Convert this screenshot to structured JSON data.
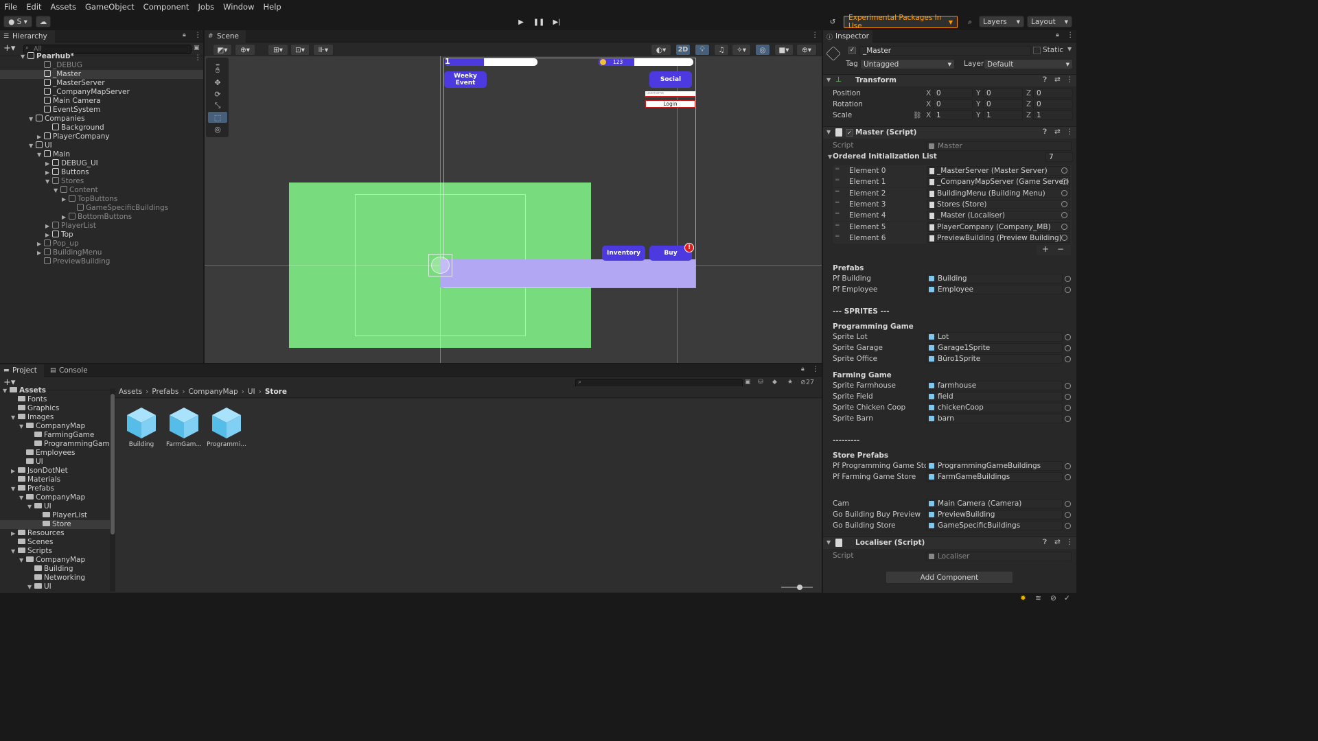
{
  "menu": [
    "File",
    "Edit",
    "Assets",
    "GameObject",
    "Component",
    "Jobs",
    "Window",
    "Help"
  ],
  "toolbar": {
    "account": "S",
    "experimental": "Experimental Packages In Use",
    "layers": "Layers",
    "layout": "Layout"
  },
  "hierarchy": {
    "tab": "Hierarchy",
    "search_placeholder": "All",
    "items": [
      {
        "label": "Pearhub*",
        "indent": 0,
        "arrow": "▼",
        "dim": false,
        "bold": true
      },
      {
        "label": "_DEBUG",
        "indent": 2,
        "arrow": "",
        "dim": true
      },
      {
        "label": "_Master",
        "indent": 2,
        "arrow": "",
        "dim": false,
        "sel": true
      },
      {
        "label": "_MasterServer",
        "indent": 2,
        "arrow": "",
        "dim": false
      },
      {
        "label": "_CompanyMapServer",
        "indent": 2,
        "arrow": "",
        "dim": false
      },
      {
        "label": "Main Camera",
        "indent": 2,
        "arrow": "",
        "dim": false
      },
      {
        "label": "EventSystem",
        "indent": 2,
        "arrow": "",
        "dim": false
      },
      {
        "label": "Companies",
        "indent": 1,
        "arrow": "▼",
        "dim": false
      },
      {
        "label": "Background",
        "indent": 3,
        "arrow": "",
        "dim": false
      },
      {
        "label": "PlayerCompany",
        "indent": 2,
        "arrow": "▶",
        "dim": false
      },
      {
        "label": "UI",
        "indent": 1,
        "arrow": "▼",
        "dim": false
      },
      {
        "label": "Main",
        "indent": 2,
        "arrow": "▼",
        "dim": false
      },
      {
        "label": "DEBUG_UI",
        "indent": 3,
        "arrow": "▶",
        "dim": false
      },
      {
        "label": "Buttons",
        "indent": 3,
        "arrow": "▶",
        "dim": false
      },
      {
        "label": "Stores",
        "indent": 3,
        "arrow": "▼",
        "dim": true
      },
      {
        "label": "Content",
        "indent": 4,
        "arrow": "▼",
        "dim": true
      },
      {
        "label": "TopButtons",
        "indent": 5,
        "arrow": "▶",
        "dim": true
      },
      {
        "label": "GameSpecificBuildings",
        "indent": 6,
        "arrow": "",
        "dim": true
      },
      {
        "label": "BottomButtons",
        "indent": 5,
        "arrow": "▶",
        "dim": true
      },
      {
        "label": "PlayerList",
        "indent": 3,
        "arrow": "▶",
        "dim": true
      },
      {
        "label": "Top",
        "indent": 3,
        "arrow": "▶",
        "dim": false
      },
      {
        "label": "Pop_up",
        "indent": 2,
        "arrow": "▶",
        "dim": true
      },
      {
        "label": "BuildingMenu",
        "indent": 2,
        "arrow": "▶",
        "dim": true
      },
      {
        "label": "PreviewBuilding",
        "indent": 2,
        "arrow": "",
        "dim": true
      }
    ]
  },
  "scene": {
    "tab": "Scene",
    "mode_2d": "2D",
    "level": "1",
    "progress_value": "100",
    "progress_fraction": 0.42,
    "coins": "123",
    "weekly_event": "Weeky Event",
    "social": "Social",
    "username_placeholder": "username",
    "login": "Login",
    "inventory": "Inventory",
    "buy": "Buy",
    "badge": "!"
  },
  "project": {
    "tabs": [
      "Project",
      "Console"
    ],
    "hidden_count": "27",
    "tree": [
      {
        "label": "Assets",
        "indent": 0,
        "arrow": "▼",
        "bold": true
      },
      {
        "label": "Fonts",
        "indent": 1,
        "arrow": ""
      },
      {
        "label": "Graphics",
        "indent": 1,
        "arrow": ""
      },
      {
        "label": "Images",
        "indent": 1,
        "arrow": "▼"
      },
      {
        "label": "CompanyMap",
        "indent": 2,
        "arrow": "▼"
      },
      {
        "label": "FarmingGame",
        "indent": 3,
        "arrow": ""
      },
      {
        "label": "ProgrammingGame",
        "indent": 3,
        "arrow": ""
      },
      {
        "label": "Employees",
        "indent": 2,
        "arrow": ""
      },
      {
        "label": "UI",
        "indent": 2,
        "arrow": ""
      },
      {
        "label": "JsonDotNet",
        "indent": 1,
        "arrow": "▶"
      },
      {
        "label": "Materials",
        "indent": 1,
        "arrow": ""
      },
      {
        "label": "Prefabs",
        "indent": 1,
        "arrow": "▼"
      },
      {
        "label": "CompanyMap",
        "indent": 2,
        "arrow": "▼"
      },
      {
        "label": "UI",
        "indent": 3,
        "arrow": "▼"
      },
      {
        "label": "PlayerList",
        "indent": 4,
        "arrow": ""
      },
      {
        "label": "Store",
        "indent": 4,
        "arrow": "",
        "sel": true
      },
      {
        "label": "Resources",
        "indent": 1,
        "arrow": "▶"
      },
      {
        "label": "Scenes",
        "indent": 1,
        "arrow": ""
      },
      {
        "label": "Scripts",
        "indent": 1,
        "arrow": "▼"
      },
      {
        "label": "CompanyMap",
        "indent": 2,
        "arrow": "▼"
      },
      {
        "label": "Building",
        "indent": 3,
        "arrow": ""
      },
      {
        "label": "Networking",
        "indent": 3,
        "arrow": ""
      },
      {
        "label": "UI",
        "indent": 3,
        "arrow": "▼"
      }
    ],
    "breadcrumb": [
      "Assets",
      "Prefabs",
      "CompanyMap",
      "UI",
      "Store"
    ],
    "assets": [
      "Building",
      "FarmGam...",
      "Programmi..."
    ]
  },
  "inspector": {
    "tab": "Inspector",
    "object_name": "_Master",
    "static": "Static",
    "tag_label": "Tag",
    "tag_value": "Untagged",
    "layer_label": "Layer",
    "layer_value": "Default",
    "transform": {
      "title": "Transform",
      "rows": [
        {
          "label": "Position",
          "x": "0",
          "y": "0",
          "z": "0"
        },
        {
          "label": "Rotation",
          "x": "0",
          "y": "0",
          "z": "0"
        },
        {
          "label": "Scale",
          "x": "1",
          "y": "1",
          "z": "1"
        }
      ]
    },
    "master": {
      "title": "Master (Script)",
      "script_label": "Script",
      "script_value": "Master",
      "list_title": "Ordered Initialization List",
      "list_count": "7",
      "elements": [
        {
          "label": "Element 0",
          "value": "_MasterServer (Master Server)"
        },
        {
          "label": "Element 1",
          "value": "_CompanyMapServer (Game Server)"
        },
        {
          "label": "Element 2",
          "value": "BuildingMenu (Building Menu)"
        },
        {
          "label": "Element 3",
          "value": "Stores (Store)"
        },
        {
          "label": "Element 4",
          "value": "_Master (Localiser)"
        },
        {
          "label": "Element 5",
          "value": "PlayerCompany (Company_MB)"
        },
        {
          "label": "Element 6",
          "value": "PreviewBuilding (Preview Building)"
        }
      ],
      "fields": [
        {
          "kind": "header",
          "label": "Prefabs"
        },
        {
          "kind": "field",
          "label": "Pf Building",
          "value": "Building"
        },
        {
          "kind": "field",
          "label": "Pf Employee",
          "value": "Employee"
        },
        {
          "kind": "header",
          "label": "--- SPRITES ---"
        },
        {
          "kind": "header",
          "label": "Programming Game"
        },
        {
          "kind": "field",
          "label": "Sprite Lot",
          "value": "Lot"
        },
        {
          "kind": "field",
          "label": "Sprite Garage",
          "value": "Garage1Sprite"
        },
        {
          "kind": "field",
          "label": "Sprite Office",
          "value": "Büro1Sprite"
        },
        {
          "kind": "header",
          "label": "Farming Game"
        },
        {
          "kind": "field",
          "label": "Sprite Farmhouse",
          "value": "farmhouse"
        },
        {
          "kind": "field",
          "label": "Sprite Field",
          "value": "field"
        },
        {
          "kind": "field",
          "label": "Sprite Chicken Coop",
          "value": "chickenCoop"
        },
        {
          "kind": "field",
          "label": "Sprite Barn",
          "value": "barn"
        },
        {
          "kind": "header",
          "label": "---------"
        },
        {
          "kind": "header",
          "label": "Store Prefabs"
        },
        {
          "kind": "field",
          "label": "Pf Programming Game Store",
          "value": "ProgrammingGameBuildings"
        },
        {
          "kind": "field",
          "label": "Pf Farming Game Store",
          "value": "FarmGameBuildings"
        },
        {
          "kind": "field",
          "label": "Cam",
          "value": "Main Camera (Camera)"
        },
        {
          "kind": "field",
          "label": "Go Building Buy Preview",
          "value": "PreviewBuilding"
        },
        {
          "kind": "field",
          "label": "Go Building Store",
          "value": "GameSpecificBuildings"
        }
      ]
    },
    "localiser": {
      "title": "Localiser (Script)",
      "script_label": "Script",
      "script_value": "Localiser"
    },
    "add_component": "Add Component"
  }
}
